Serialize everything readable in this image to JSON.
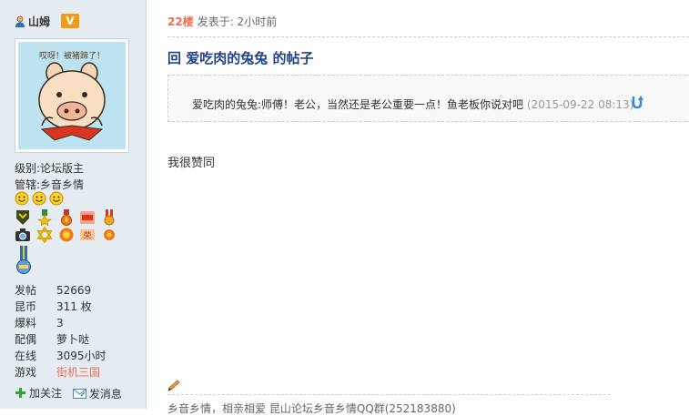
{
  "user": {
    "name": "山姆",
    "badge": "V",
    "avatar_caption": "哎呀！被猪蹄了！",
    "level_label": "级别:",
    "level_value": "论坛版主",
    "manage_label": "管辖:",
    "manage_value": "乡音乡情",
    "stats": [
      {
        "label": "发帖",
        "value": "52669",
        "link": false
      },
      {
        "label": "昆币",
        "value": "311 枚",
        "link": false
      },
      {
        "label": "爆料",
        "value": "3",
        "link": false
      },
      {
        "label": "配偶",
        "value": "萝卜哒",
        "link": false
      },
      {
        "label": "在线",
        "value": "3095小时",
        "link": false
      },
      {
        "label": "游戏",
        "value": "街机三国",
        "link": true
      }
    ],
    "actions": {
      "follow": "加关注",
      "message": "发消息"
    }
  },
  "post": {
    "floor": "22楼",
    "posted": "发表于: 2小时前",
    "title": "回 爱吃肉的兔兔 的帖子",
    "quote_text": "爱吃肉的兔兔:师傅！老公，当然还是老公重要一点！鱼老板你说对吧",
    "quote_date": "(2015-09-22 08:13)",
    "body": "我很赞同",
    "signature": "乡音乡情，相亲相爱 昆山论坛乡音乡情QQ群(252183880)"
  },
  "colors": {
    "sidebar_bg": "#e5edf2",
    "accent_orange": "#f26c4f",
    "title_blue": "#224488",
    "badge_orange": "#f39b17"
  }
}
